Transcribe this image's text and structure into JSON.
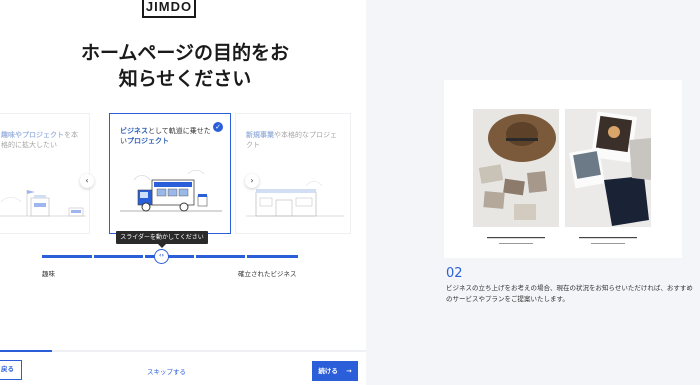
{
  "logo": "JIMDO",
  "title": "ホームページの目的をお知らせください",
  "cards": [
    {
      "highlight": "趣味やプロジェクト",
      "normal": "を本格的に拡大したい"
    },
    {
      "highlight1": "ビジネス",
      "normal1": "として軌道に乗せたい",
      "highlight2": "プロジェクト"
    },
    {
      "highlight": "新規事業",
      "normal": "や本格的なプロジェクト"
    }
  ],
  "tooltip": "スライダーを動かしてください",
  "slider": {
    "min_label": "趣味",
    "max_label": "確立されたビジネス",
    "value": 0.47
  },
  "progress": {
    "value": 0.14
  },
  "buttons": {
    "back": "戻る",
    "skip": "スキップする",
    "next": "続ける",
    "next_icon": "→"
  },
  "right_panel": {
    "number": "02",
    "description": "ビジネスの立ち上げをお考えの場合、現在の状況をお知らせいただければ、おすすめのサービスやプランをご提案いたします。"
  },
  "icons": {
    "prev": "chevron-left-icon",
    "next": "chevron-right-icon",
    "check": "check-icon",
    "slider": "code-arrows-icon"
  },
  "colors": {
    "accent": "#2b5fd9",
    "bg_right": "#f3f5f9"
  }
}
